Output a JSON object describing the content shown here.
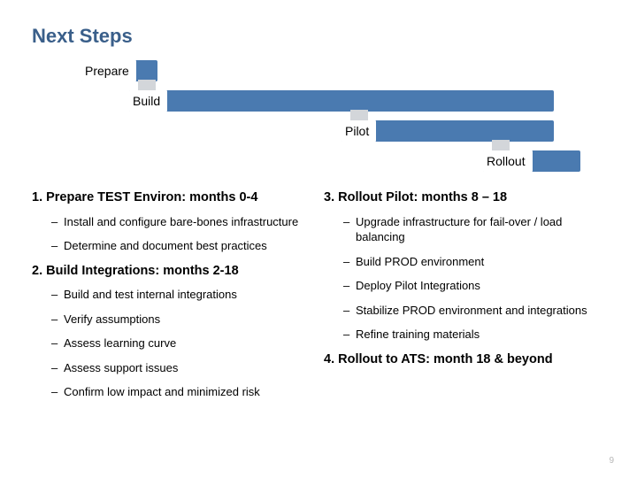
{
  "title": "Next Steps",
  "stages": {
    "s1": "Prepare",
    "s2": "Build",
    "s3": "Pilot",
    "s4": "Rollout"
  },
  "left": {
    "h1": "1. Prepare TEST Environ: months 0-4",
    "h1_items": [
      "Install and configure bare-bones infrastructure",
      "Determine and document best practices"
    ],
    "h2": "2. Build Integrations:  months 2-18",
    "h2_items": [
      "Build and test internal integrations",
      "Verify assumptions",
      "Assess learning curve",
      "Assess support issues",
      "Confirm low impact and minimized risk"
    ]
  },
  "right": {
    "h3": "3. Rollout Pilot: months 8 – 18",
    "h3_items": [
      "Upgrade infrastructure for fail-over / load balancing",
      "Build PROD environment",
      "Deploy Pilot Integrations",
      "Stabilize PROD environment and integrations",
      "Refine training materials"
    ],
    "h4": "4. Rollout to ATS:  month 18 & beyond"
  },
  "page_number": "9"
}
